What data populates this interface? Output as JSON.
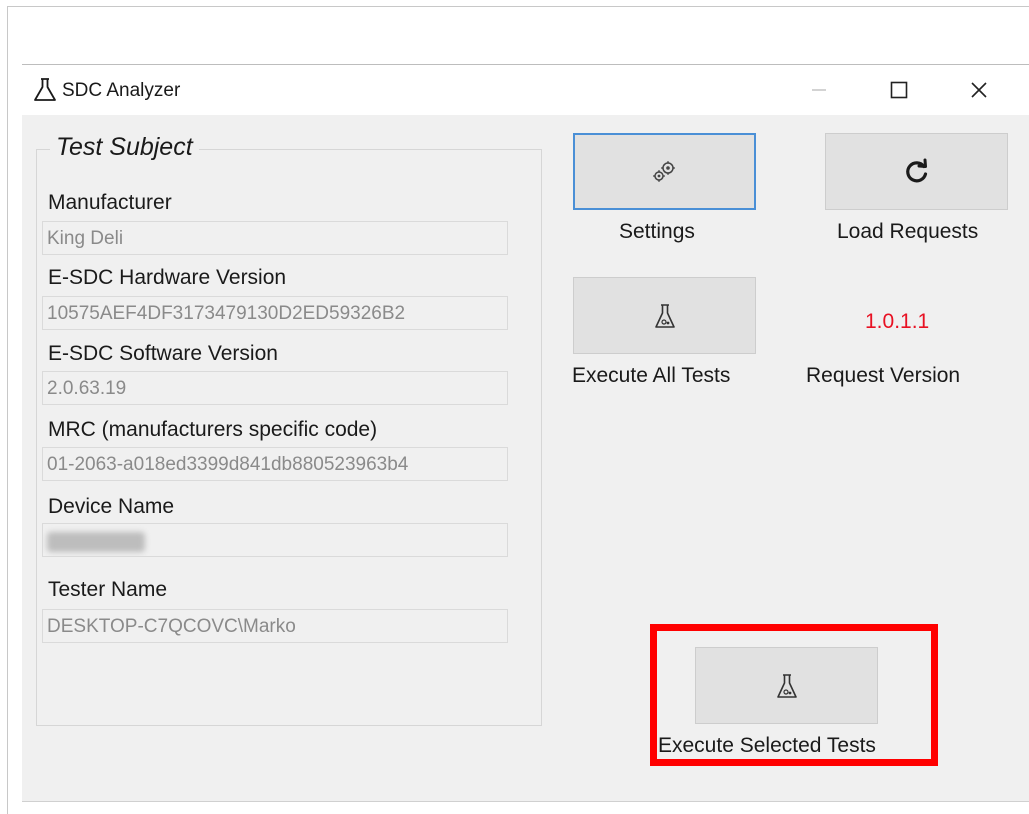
{
  "window": {
    "title": "SDC Analyzer",
    "controls": {
      "minimize": "—",
      "maximize": "☐",
      "close": "✕"
    }
  },
  "test_subject": {
    "legend": "Test Subject",
    "fields": [
      {
        "label": "Manufacturer",
        "value": "King Deli"
      },
      {
        "label": "E-SDC Hardware Version",
        "value": "10575AEF4DF3173479130D2ED59326B2"
      },
      {
        "label": "E-SDC Software Version",
        "value": "2.0.63.19"
      },
      {
        "label": "MRC (manufacturers specific code)",
        "value": "01-2063-a018ed3399d841db880523963b4"
      },
      {
        "label": "Device Name",
        "value": ""
      },
      {
        "label": "Tester Name",
        "value": "DESKTOP-C7QCOVC\\Marko"
      }
    ]
  },
  "buttons": {
    "settings": "Settings",
    "load_requests": "Load Requests",
    "execute_all": "Execute All Tests",
    "execute_selected": "Execute Selected Tests"
  },
  "request_version": {
    "value": "1.0.1.1",
    "label": "Request Version"
  },
  "colors": {
    "version_text": "#e81123",
    "highlight_border": "#ff0000",
    "focus_border": "#4a8fd6"
  },
  "icons": {
    "app": "flask-icon",
    "settings": "gears-icon",
    "load_requests": "refresh-icon",
    "execute": "flask-icon"
  }
}
